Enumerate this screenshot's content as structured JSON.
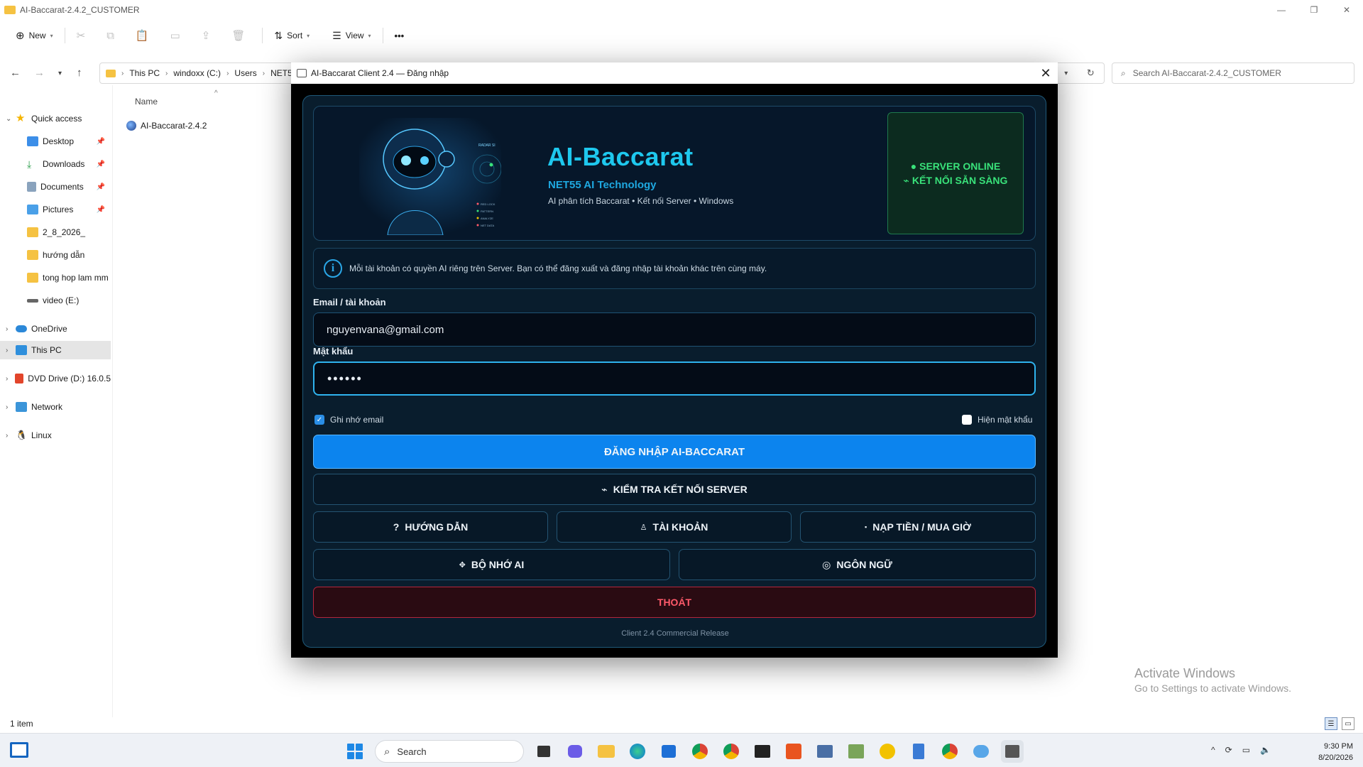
{
  "explorer": {
    "window_title": "AI-Baccarat-2.4.2_CUSTOMER",
    "toolbar": {
      "new_label": "New",
      "sort_label": "Sort",
      "view_label": "View",
      "more_label": "•••"
    },
    "address": {
      "crumbs": [
        "This PC",
        "windoxx (C:)",
        "Users",
        "NET5"
      ]
    },
    "search_placeholder": "Search AI-Baccarat-2.4.2_CUSTOMER",
    "nav": {
      "quick_access": "Quick access",
      "items": [
        {
          "label": "Desktop",
          "pinned": true
        },
        {
          "label": "Downloads",
          "pinned": true
        },
        {
          "label": "Documents",
          "pinned": true
        },
        {
          "label": "Pictures",
          "pinned": true
        },
        {
          "label": "2_8_2026_",
          "pinned": false
        },
        {
          "label": "hướng dẫn",
          "pinned": false
        },
        {
          "label": "tong hop lam mm",
          "pinned": false
        },
        {
          "label": "video (E:)",
          "pinned": false
        }
      ],
      "onedrive": "OneDrive",
      "this_pc": "This PC",
      "dvd": "DVD Drive (D:) 16.0.5",
      "network": "Network",
      "linux": "Linux"
    },
    "column_name": "Name",
    "files": [
      {
        "name": "AI-Baccarat-2.4.2"
      }
    ],
    "status_count": "1 item"
  },
  "watermark": {
    "line1": "Activate Windows",
    "line2": "Go to Settings to activate Windows."
  },
  "taskbar": {
    "search_label": "Search",
    "time": "9:30 PM",
    "date": "8/20/2026"
  },
  "dialog": {
    "title": "AI-Baccarat Client 2.4 — Đăng nhập",
    "hero": {
      "title": "AI-Baccarat",
      "subtitle": "NET55 AI Technology",
      "desc": "AI phân tích Baccarat • Kết nối Server • Windows",
      "radar_label": "RADAR SI",
      "legend": [
        "RED LOCK",
        "PATTERN",
        "ANALYZE",
        "NET DATA"
      ]
    },
    "server": {
      "line1": "● SERVER ONLINE",
      "line2": "⌁ KẾT NỐI SẴN SÀNG"
    },
    "info": "Mỗi tài khoản có quyền AI riêng trên Server. Bạn có thể đăng xuất và đăng nhập tài khoản khác trên cùng máy.",
    "email_label": "Email / tài khoản",
    "email_value": "nguyenvana@gmail.com",
    "password_label": "Mật khẩu",
    "password_value": "••••••",
    "remember_label": "Ghi nhớ email",
    "show_password_label": "Hiện mật khẩu",
    "buttons": {
      "login": "ĐĂNG NHẬP AI-BACCARAT",
      "check": "KIỂM TRA KẾT NỐI SERVER",
      "guide": "HƯỚNG DẪN",
      "account": "TÀI KHOẢN",
      "topup": "NẠP TIỀN / MUA GIỜ",
      "memory": "BỘ NHỚ AI",
      "language": "NGÔN NGỮ",
      "exit": "THOÁT"
    },
    "footer": "Client 2.4  Commercial Release"
  },
  "colors": {
    "accent": "#0c84ee",
    "title_cyan": "#1ec8ee",
    "online_green": "#39e27a",
    "danger": "#ff5a6a",
    "panel_bg": "#091d2d"
  }
}
